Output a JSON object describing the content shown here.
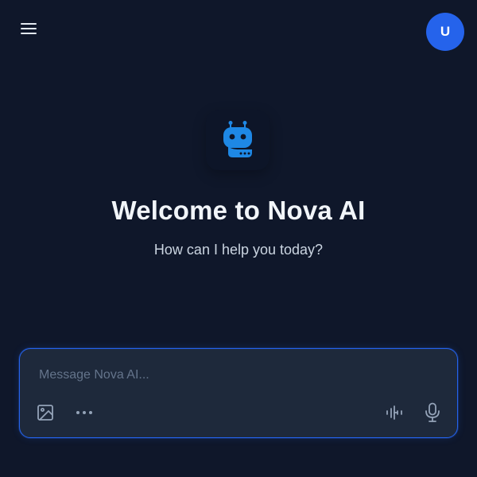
{
  "header": {
    "menu_icon": "hamburger-menu-icon",
    "avatar_initial": "U",
    "avatar_color": "#2563eb"
  },
  "welcome": {
    "logo_icon": "robot-chat-icon",
    "title": "Welcome to Nova AI",
    "subtitle": "How can I help you today?"
  },
  "composer": {
    "placeholder": "Message Nova AI...",
    "value": "",
    "tools": {
      "image_icon": "image-icon",
      "more_icon": "more-horizontal-icon",
      "voice_mode_icon": "audio-waveform-icon",
      "mic_icon": "microphone-icon"
    }
  },
  "colors": {
    "background": "#0f172a",
    "accent": "#2563eb",
    "logo": "#1e88e5",
    "composer_bg": "#1e293b"
  }
}
